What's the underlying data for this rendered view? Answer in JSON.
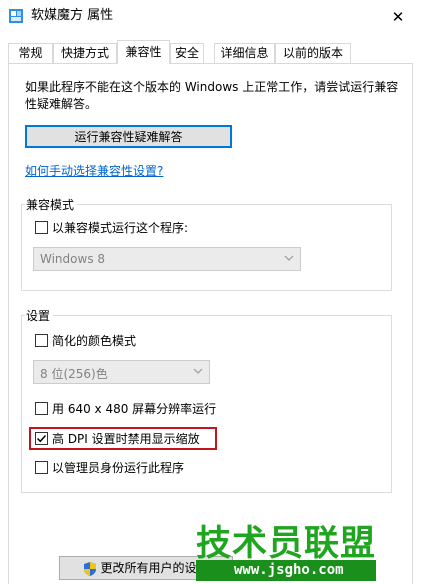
{
  "window": {
    "title": "软媒魔方 属性",
    "close_glyph": "✕"
  },
  "tabs": [
    {
      "label": "常规",
      "active": false
    },
    {
      "label": "快捷方式",
      "active": false
    },
    {
      "label": "兼容性",
      "active": true
    },
    {
      "label": "安全",
      "active": false
    },
    {
      "label": "详细信息",
      "active": false
    },
    {
      "label": "以前的版本",
      "active": false
    }
  ],
  "compat": {
    "info_text": "如果此程序不能在这个版本的 Windows 上正常工作，请尝试运行兼容性疑难解答。",
    "troubleshoot_button": "运行兼容性疑难解答",
    "manual_link": "如何手动选择兼容性设置?"
  },
  "compat_mode": {
    "group_title": "兼容模式",
    "checkbox_label": "以兼容模式运行这个程序:",
    "checked": false,
    "os_select": "Windows 8"
  },
  "settings": {
    "group_title": "设置",
    "reduced_color": {
      "label": "简化的颜色模式",
      "checked": false
    },
    "color_select": "8 位(256)色",
    "resolution_640": {
      "label": "用 640 x 480 屏幕分辨率运行",
      "checked": false
    },
    "high_dpi": {
      "label": "高 DPI 设置时禁用显示缩放",
      "checked": true
    },
    "run_as_admin": {
      "label": "以管理员身份运行此程序",
      "checked": false
    }
  },
  "change_all_button": "更改所有用户的设置",
  "watermark": {
    "title": "技术员联盟",
    "url": "www.jsgho.com"
  },
  "colors": {
    "accent": "#0078d7",
    "highlight": "#c3151c",
    "watermark": "#1fa51f"
  }
}
